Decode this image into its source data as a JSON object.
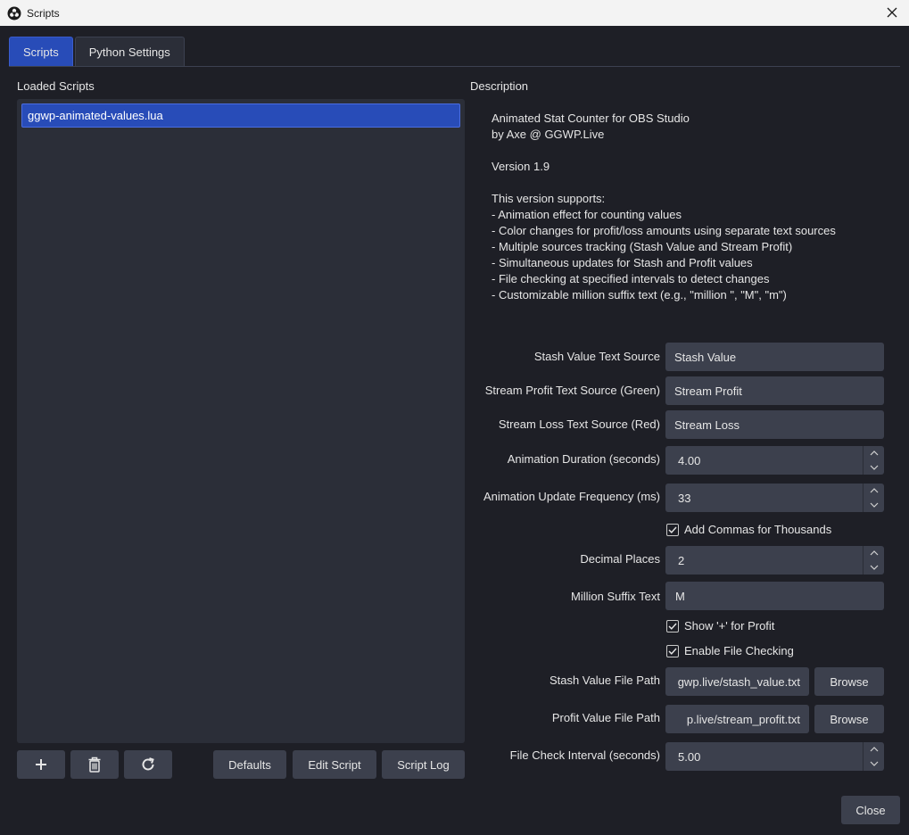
{
  "window": {
    "title": "Scripts",
    "icon": "obs-logo-icon"
  },
  "tabs": [
    {
      "label": "Scripts",
      "active": true
    },
    {
      "label": "Python Settings",
      "active": false
    }
  ],
  "loaded_scripts": {
    "label": "Loaded Scripts",
    "items": [
      "ggwp-animated-values.lua"
    ]
  },
  "description": {
    "label": "Description",
    "text": "Animated Stat Counter for OBS Studio\nby Axe @ GGWP.Live\n\nVersion 1.9\n\nThis version supports:\n- Animation effect for counting values\n- Color changes for profit/loss amounts using separate text sources\n- Multiple sources tracking (Stash Value and Stream Profit)\n- Simultaneous updates for Stash and Profit values\n- File checking at specified intervals to detect changes\n- Customizable million suffix text (e.g., \"million \", \"M\", \"m\")"
  },
  "settings": {
    "stash_source": {
      "label": "Stash Value Text Source",
      "value": "Stash Value"
    },
    "profit_source": {
      "label": "Stream Profit Text Source (Green)",
      "value": "Stream Profit"
    },
    "loss_source": {
      "label": "Stream Loss Text Source (Red)",
      "value": "Stream Loss"
    },
    "anim_duration": {
      "label": "Animation Duration (seconds)",
      "value": "4.00"
    },
    "anim_freq": {
      "label": "Animation Update Frequency (ms)",
      "value": "33"
    },
    "add_commas": {
      "label": "Add Commas for Thousands",
      "checked": true
    },
    "decimal_places": {
      "label": "Decimal Places",
      "value": "2"
    },
    "million_suffix": {
      "label": "Million Suffix Text",
      "value": "M"
    },
    "show_plus": {
      "label": "Show '+' for Profit",
      "checked": true
    },
    "file_checking": {
      "label": "Enable File Checking",
      "checked": true
    },
    "stash_path": {
      "label": "Stash Value File Path",
      "value": "gwp.live/stash_value.txt"
    },
    "profit_path": {
      "label": "Profit Value File Path",
      "value": "p.live/stream_profit.txt"
    },
    "check_interval": {
      "label": "File Check Interval (seconds)",
      "value": "5.00"
    }
  },
  "buttons": {
    "browse": "Browse",
    "defaults": "Defaults",
    "edit_script": "Edit Script",
    "script_log": "Script Log",
    "close": "Close"
  },
  "icons": {
    "add": "plus-icon",
    "remove": "trash-icon",
    "reload": "refresh-icon"
  },
  "colors": {
    "accent": "#284cb8",
    "background": "#1e1f26",
    "panel": "#2b2e38",
    "control": "#3c404d"
  }
}
